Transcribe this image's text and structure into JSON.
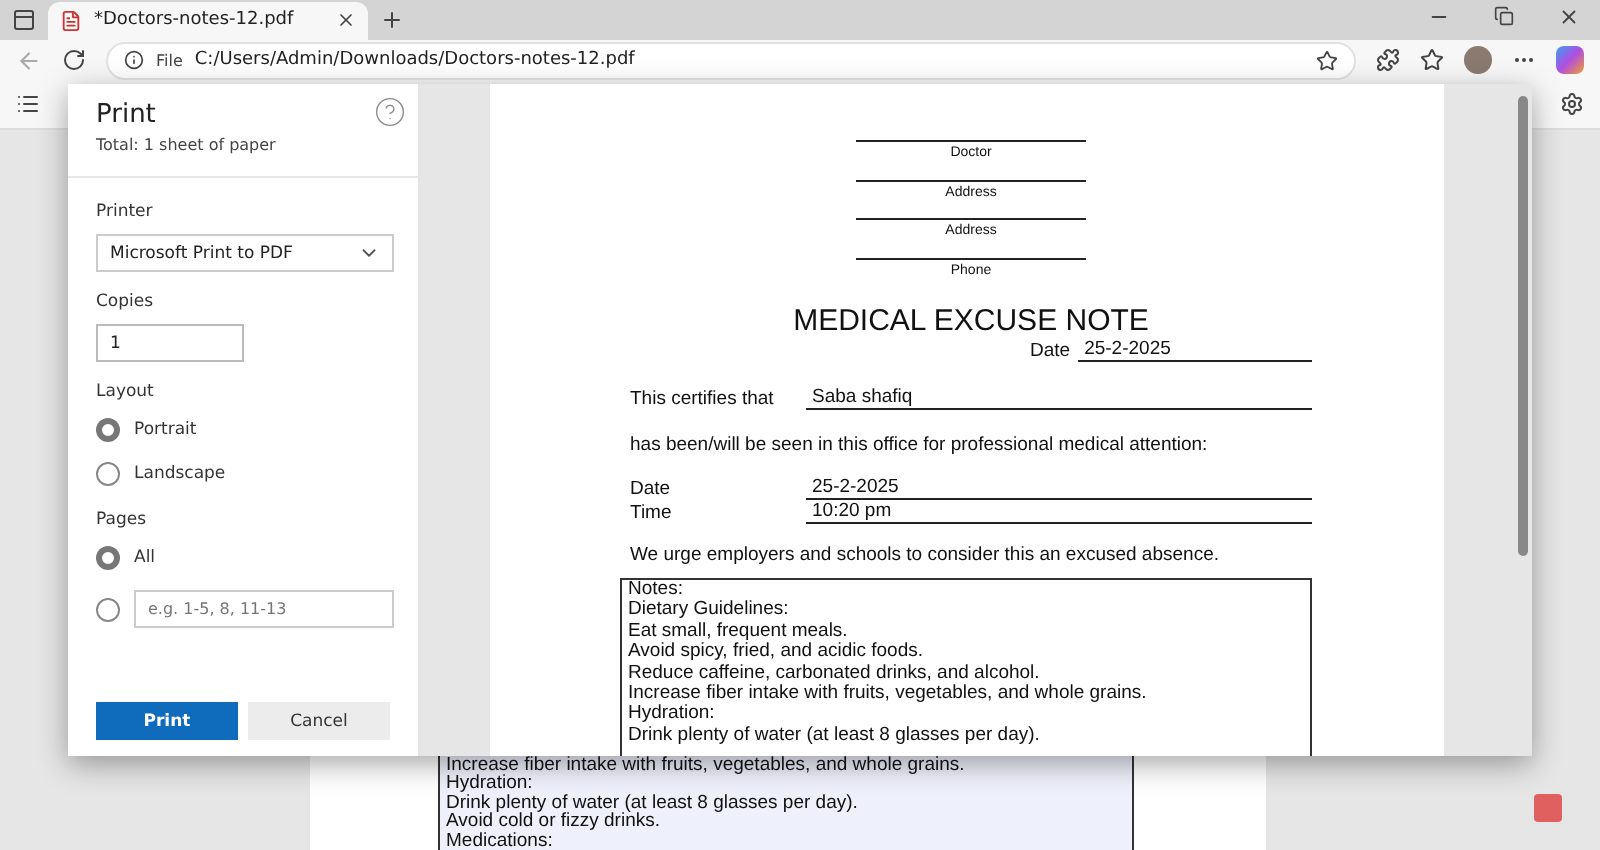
{
  "browser": {
    "tab_title": "*Doctors-notes-12.pdf",
    "address_prefix": "File",
    "url": "C:/Users/Admin/Downloads/Doctors-notes-12.pdf"
  },
  "background_notes": [
    "Increase fiber intake with fruits, vegetables, and whole grains.",
    "Hydration:",
    "Drink plenty of water (at least 8 glasses per day).",
    "Avoid cold or fizzy drinks.",
    "Medications:"
  ],
  "print_dialog": {
    "title": "Print",
    "subtitle": "Total: 1 sheet of paper",
    "printer": {
      "label": "Printer",
      "value": "Microsoft Print to PDF"
    },
    "copies": {
      "label": "Copies",
      "value": "1"
    },
    "layout": {
      "label": "Layout",
      "options": [
        {
          "label": "Portrait",
          "selected": true
        },
        {
          "label": "Landscape",
          "selected": false
        }
      ]
    },
    "pages": {
      "label": "Pages",
      "options": [
        {
          "kind": "text",
          "label": "All",
          "selected": true
        },
        {
          "kind": "input",
          "placeholder": "e.g. 1-5, 8, 11-13",
          "selected": false
        }
      ]
    },
    "buttons": [
      {
        "kind": "primary",
        "label": "Print"
      },
      {
        "kind": "secondary",
        "label": "Cancel"
      }
    ]
  },
  "preview": {
    "header_fields": [
      "Doctor",
      "Address",
      "Address",
      "Phone"
    ],
    "title": "MEDICAL EXCUSE NOTE",
    "date_label": "Date",
    "date_value": "25-2-2025",
    "certifies_label": "This certifies that",
    "patient": "Saba shafiq",
    "attention": "has been/will be seen in this office for professional medical attention:",
    "visit": [
      {
        "label": "Date",
        "value": "25-2-2025"
      },
      {
        "label": "Time",
        "value": "10:20 pm"
      }
    ],
    "statement": "We urge employers and schools to consider this an excused absence.",
    "notes": [
      "Notes:",
      "Dietary Guidelines:",
      "Eat small, frequent meals.",
      "Avoid spicy, fried, and acidic foods.",
      "Reduce caffeine, carbonated drinks, and alcohol.",
      "Increase fiber intake with fruits, vegetables, and whole grains.",
      "Hydration:",
      "Drink plenty of water (at least 8 glasses per day)."
    ]
  }
}
